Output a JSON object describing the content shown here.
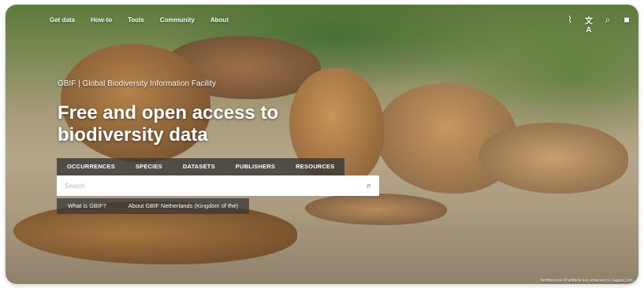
{
  "nav": {
    "items": [
      "Get data",
      "How-to",
      "Tools",
      "Community",
      "About"
    ]
  },
  "header_icons": [
    "activity-icon",
    "translate-icon",
    "search-icon",
    "feedback-icon"
  ],
  "hero": {
    "org_name": "GBIF | Global Biodiversity Information Facility",
    "headline": "Free and open access to biodiversity data",
    "caption": "Northern lion (Panthera leo) observed in Gujarat, Ind..."
  },
  "search": {
    "tabs": [
      "OCCURRENCES",
      "SPECIES",
      "DATASETS",
      "PUBLISHERS",
      "RESOURCES"
    ],
    "placeholder": "Search",
    "links": [
      "What is GBIF?",
      "About GBIF Netherlands (Kingdom of the)"
    ]
  },
  "colors": {
    "tab_bar": "#373737",
    "text": "#ffffff"
  }
}
